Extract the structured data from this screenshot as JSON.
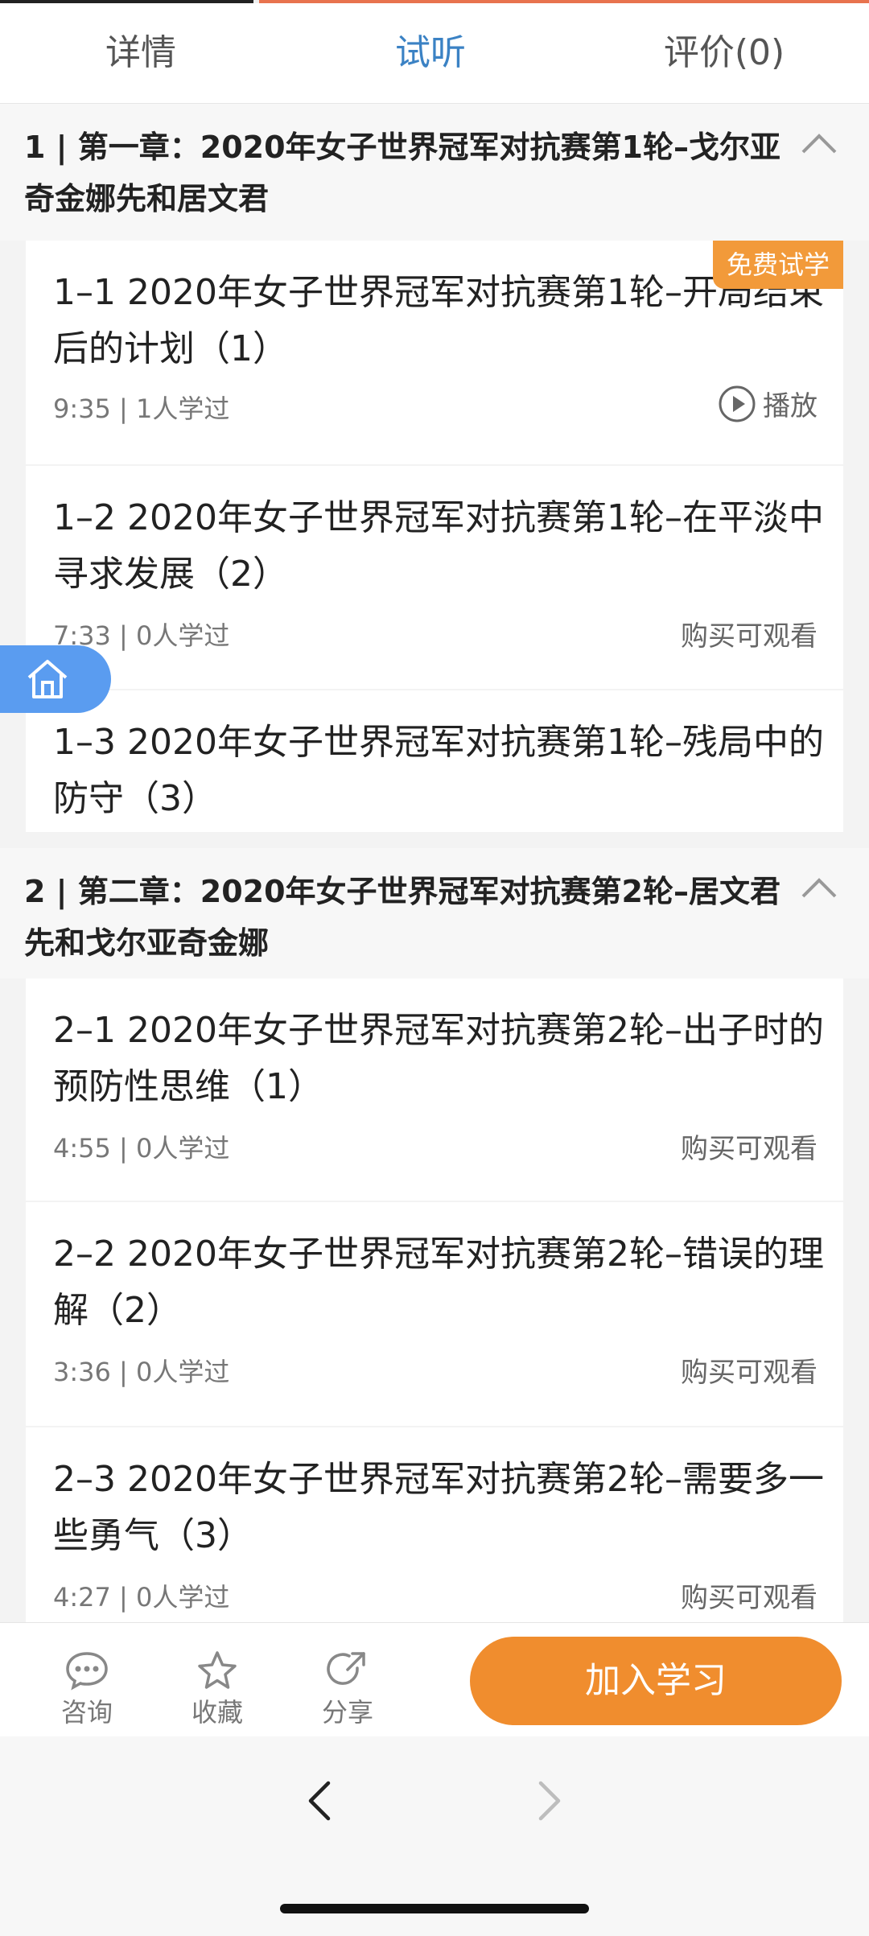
{
  "tabs": [
    "详情",
    "试听",
    "评价(0)"
  ],
  "active_tab": "试听",
  "accent_color": "#3b82c4",
  "chapters": [
    {
      "title": "1 | 第一章：2020年女子世界冠军对抗赛第1轮–戈尔亚奇金娜先和居文君",
      "lessons": [
        {
          "title": "1–1 2020年女子世界冠军对抗赛第1轮–开局结束后的计划（1）",
          "meta": "9:35 | 1人学过",
          "action": "播放",
          "badge": "免费试学"
        },
        {
          "title": "1–2 2020年女子世界冠军对抗赛第1轮–在平淡中寻求发展（2）",
          "meta": "7:33 | 0人学过",
          "action": "购买可观看"
        },
        {
          "title": "1–3 2020年女子世界冠军对抗赛第1轮–残局中的防守（3）"
        }
      ]
    },
    {
      "title": "2 | 第二章：2020年女子世界冠军对抗赛第2轮–居文君先和戈尔亚奇金娜",
      "lessons": [
        {
          "title": "2–1 2020年女子世界冠军对抗赛第2轮–出子时的预防性思维（1）",
          "meta": "4:55 | 0人学过",
          "action": "购买可观看"
        },
        {
          "title": "2–2 2020年女子世界冠军对抗赛第2轮–错误的理解（2）",
          "meta": "3:36 | 0人学过",
          "action": "购买可观看"
        },
        {
          "title": "2–3 2020年女子世界冠军对抗赛第2轮–需要多一些勇气（3）",
          "meta": "4:27 | 0人学过",
          "action": "购买可观看"
        }
      ]
    }
  ],
  "bottom": {
    "consult": "咨询",
    "favorite": "收藏",
    "share": "分享",
    "join": "加入学习"
  },
  "icons": [
    "home-icon",
    "play-icon",
    "chevron-up-icon",
    "chat-icon",
    "star-icon",
    "share-icon",
    "back-arrow-icon",
    "forward-arrow-icon"
  ]
}
